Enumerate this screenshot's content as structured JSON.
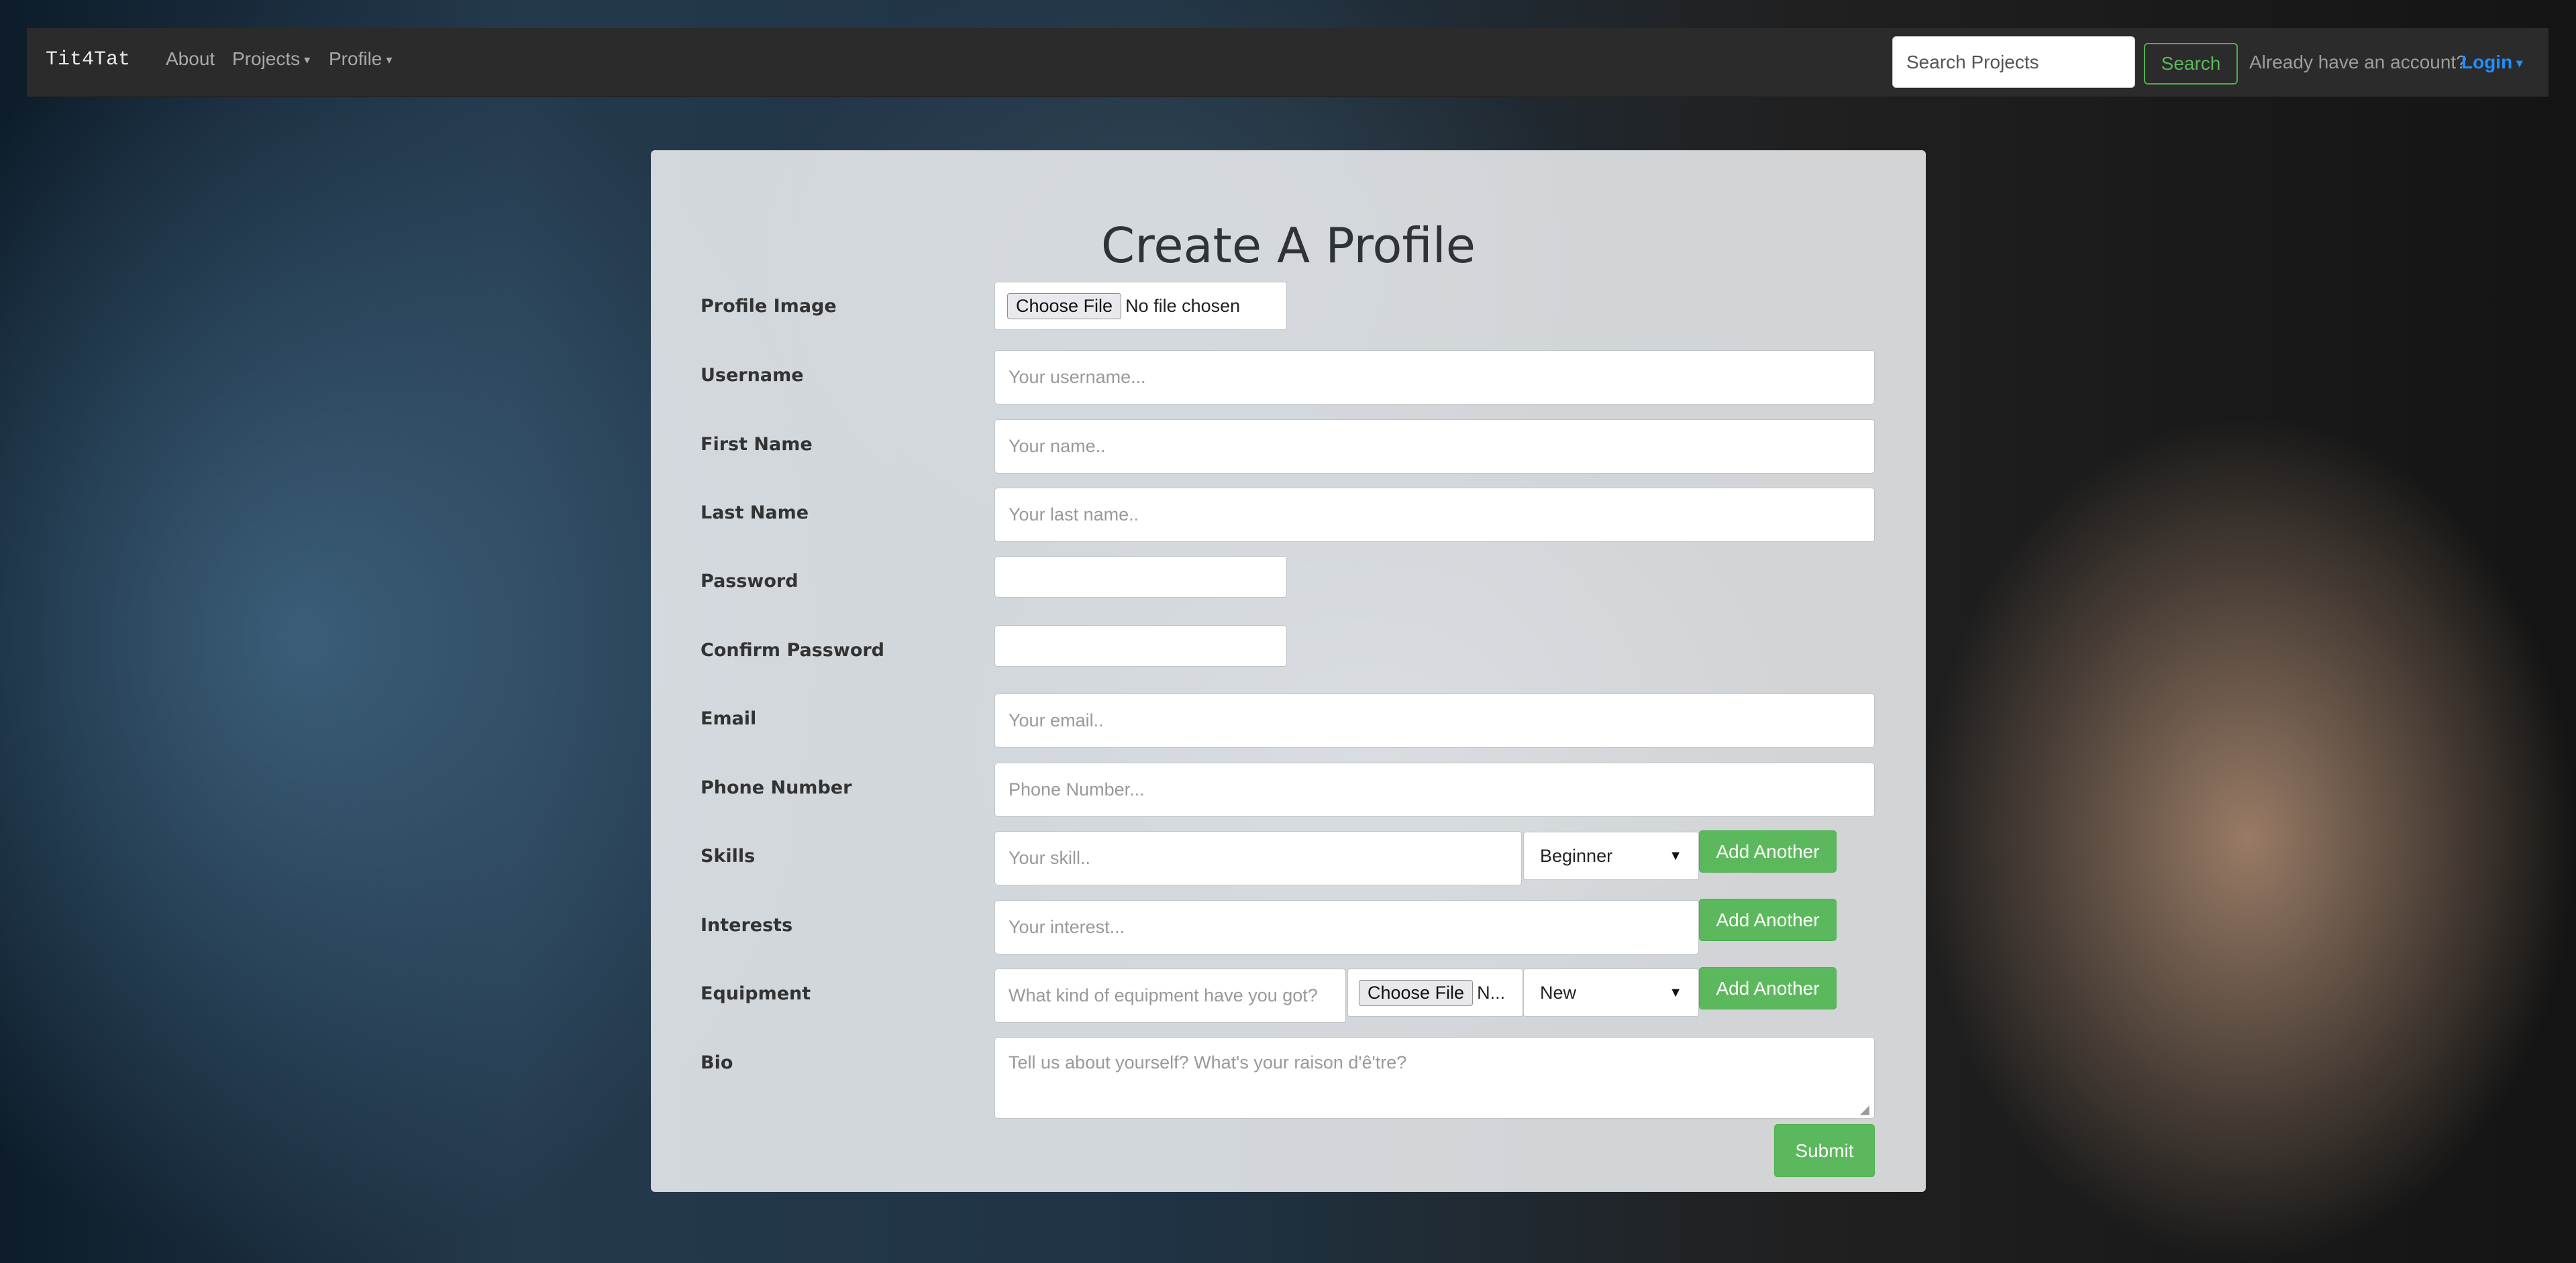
{
  "navbar": {
    "brand": "Tit4Tat",
    "about": "About",
    "projects": "Projects",
    "profile": "Profile",
    "search_placeholder": "Search Projects",
    "search_button": "Search",
    "already_text": "Already have an account?",
    "login": "Login"
  },
  "form": {
    "title": "Create A Profile",
    "profile_image": {
      "label": "Profile Image",
      "choose": "Choose File",
      "status": "No file chosen"
    },
    "username": {
      "label": "Username",
      "placeholder": "Your username..."
    },
    "first_name": {
      "label": "First Name",
      "placeholder": "Your name.."
    },
    "last_name": {
      "label": "Last Name",
      "placeholder": "Your last name.."
    },
    "password": {
      "label": "Password"
    },
    "confirm_password": {
      "label": "Confirm Password"
    },
    "email": {
      "label": "Email",
      "placeholder": "Your email.."
    },
    "phone": {
      "label": "Phone Number",
      "placeholder": "Phone Number..."
    },
    "skills": {
      "label": "Skills",
      "placeholder": "Your skill..",
      "level": "Beginner",
      "add": "Add Another"
    },
    "interests": {
      "label": "Interests",
      "placeholder": "Your interest...",
      "add": "Add Another"
    },
    "equipment": {
      "label": "Equipment",
      "placeholder": "What kind of equipment have you got?",
      "choose": "Choose File",
      "status": "N...",
      "condition": "New",
      "add": "Add Another"
    },
    "bio": {
      "label": "Bio",
      "placeholder": "Tell us about yourself? What's your raison d'ê'tre?"
    },
    "submit": "Submit"
  }
}
